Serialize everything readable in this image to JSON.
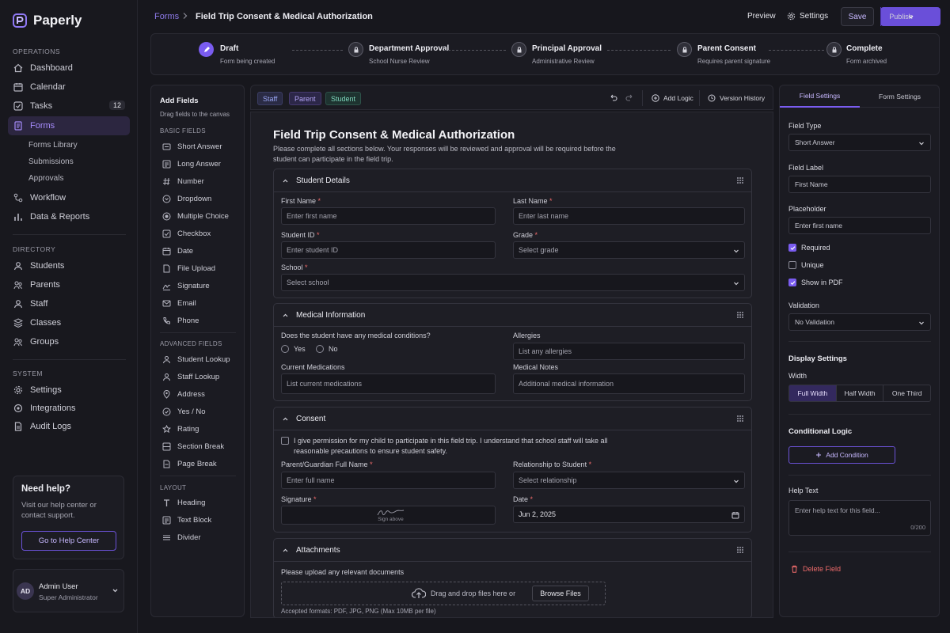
{
  "app": {
    "name": "Paperly"
  },
  "sidebar": {
    "sections": {
      "operations": "Operations",
      "directory": "Directory",
      "system": "System"
    },
    "operations": [
      {
        "label": "Dashboard"
      },
      {
        "label": "Calendar"
      },
      {
        "label": "Tasks",
        "badge": "12"
      },
      {
        "label": "Forms"
      },
      {
        "label": "Workflow"
      },
      {
        "label": "Data & Reports"
      }
    ],
    "forms_sub": [
      "Forms Library",
      "Submissions",
      "Approvals"
    ],
    "directory": [
      {
        "label": "Students"
      },
      {
        "label": "Parents"
      },
      {
        "label": "Staff"
      },
      {
        "label": "Classes"
      },
      {
        "label": "Groups"
      }
    ],
    "system": [
      {
        "label": "Settings"
      },
      {
        "label": "Integrations"
      },
      {
        "label": "Audit Logs"
      }
    ],
    "help": {
      "title": "Need help?",
      "text": "Visit our help center or contact support.",
      "button": "Go to Help Center"
    },
    "user": {
      "initials": "AD",
      "name": "Admin User",
      "role": "Super Administrator"
    }
  },
  "topbar": {
    "breadcrumb_root": "Forms",
    "breadcrumb_title": "Field Trip Consent & Medical Authorization",
    "preview": "Preview",
    "settings": "Settings",
    "save": "Save",
    "publish": "Publish"
  },
  "stepper": [
    {
      "title": "Draft",
      "subtitle": "Form being created",
      "status": "active"
    },
    {
      "title": "Department Approval",
      "subtitle": "School Nurse Review",
      "status": "pending"
    },
    {
      "title": "Principal Approval",
      "subtitle": "Administrative Review",
      "status": "pending"
    },
    {
      "title": "Parent Consent",
      "subtitle": "Requires parent signature",
      "status": "pending"
    },
    {
      "title": "Complete",
      "subtitle": "Form archived",
      "status": "pending"
    }
  ],
  "fields_panel": {
    "title": "Add Fields",
    "subtitle": "Drag fields to the canvas",
    "basic_label": "Basic Fields",
    "basic": [
      "Short Answer",
      "Long Answer",
      "Number",
      "Dropdown",
      "Multiple Choice",
      "Checkbox",
      "Date",
      "File Upload",
      "Signature",
      "Email",
      "Phone"
    ],
    "advanced_label": "Advanced Fields",
    "advanced": [
      "Student Lookup",
      "Staff Lookup",
      "Address",
      "Yes / No",
      "Rating",
      "Section Break",
      "Page Break"
    ],
    "layout_label": "Layout",
    "layout": [
      "Heading",
      "Text Block",
      "Divider"
    ]
  },
  "canvas_toolbar": {
    "roles": [
      "Staff",
      "Parent",
      "Student"
    ],
    "add_logic": "Add Logic",
    "version_history": "Version History"
  },
  "form": {
    "title": "Field Trip Consent & Medical Authorization",
    "description": "Please complete all sections below. Your responses will be reviewed and approval will be required before the student can participate in the field trip.",
    "student": {
      "heading": "Student Details",
      "first_name_label": "First Name",
      "first_name_ph": "Enter first name",
      "last_name_label": "Last Name",
      "last_name_ph": "Enter last name",
      "student_id_label": "Student ID",
      "student_id_ph": "Enter student ID",
      "grade_label": "Grade",
      "grade_ph": "Select grade",
      "school_label": "School",
      "school_ph": "Select school"
    },
    "medical": {
      "heading": "Medical Information",
      "question": "Does the student have any medical conditions?",
      "yes": "Yes",
      "no": "No",
      "allergies_label": "Allergies",
      "allergies_ph": "List any allergies",
      "meds_label": "Current Medications",
      "meds_ph": "List current medications",
      "notes_label": "Medical Notes",
      "notes_ph": "Additional medical information"
    },
    "consent": {
      "heading": "Consent",
      "statement": "I give permission for my child to participate in this field trip. I understand that school staff will take all reasonable precautions to ensure student safety.",
      "guardian_label": "Parent/Guardian Full Name",
      "guardian_ph": "Enter full name",
      "relationship_label": "Relationship to Student",
      "relationship_ph": "Select relationship",
      "signature_label": "Signature",
      "signature_hint": "Sign above",
      "date_label": "Date",
      "date_value": "Jun 2, 2025"
    },
    "attachments": {
      "heading": "Attachments",
      "prompt": "Please upload any relevant documents",
      "drop_text": "Drag and drop files here or",
      "browse": "Browse Files",
      "formats": "Accepted formats: PDF, JPG, PNG (Max 10MB per file)"
    }
  },
  "right_panel": {
    "tabs": [
      "Field Settings",
      "Form Settings"
    ],
    "field_type_label": "Field Type",
    "field_type": "Short Answer",
    "field_label_label": "Field Label",
    "field_label": "First Name",
    "placeholder_label": "Placeholder",
    "placeholder": "Enter first name",
    "checks": [
      {
        "label": "Required",
        "checked": true
      },
      {
        "label": "Unique",
        "checked": false
      },
      {
        "label": "Show in PDF",
        "checked": true
      }
    ],
    "validation_label": "Validation",
    "validation": "No Validation",
    "display_label": "Display Settings",
    "width_label": "Width",
    "width_options": [
      "Full Width",
      "Half Width",
      "One Third"
    ],
    "conditional_label": "Conditional Logic",
    "add_condition": "Add Condition",
    "help_label": "Help Text",
    "help_ph": "Enter help text for this field...",
    "help_count": "0/200",
    "delete": "Delete Field"
  },
  "colors": {
    "accent": "#7a5cf0",
    "bg": "#17171d",
    "danger": "#ef6b6b"
  }
}
